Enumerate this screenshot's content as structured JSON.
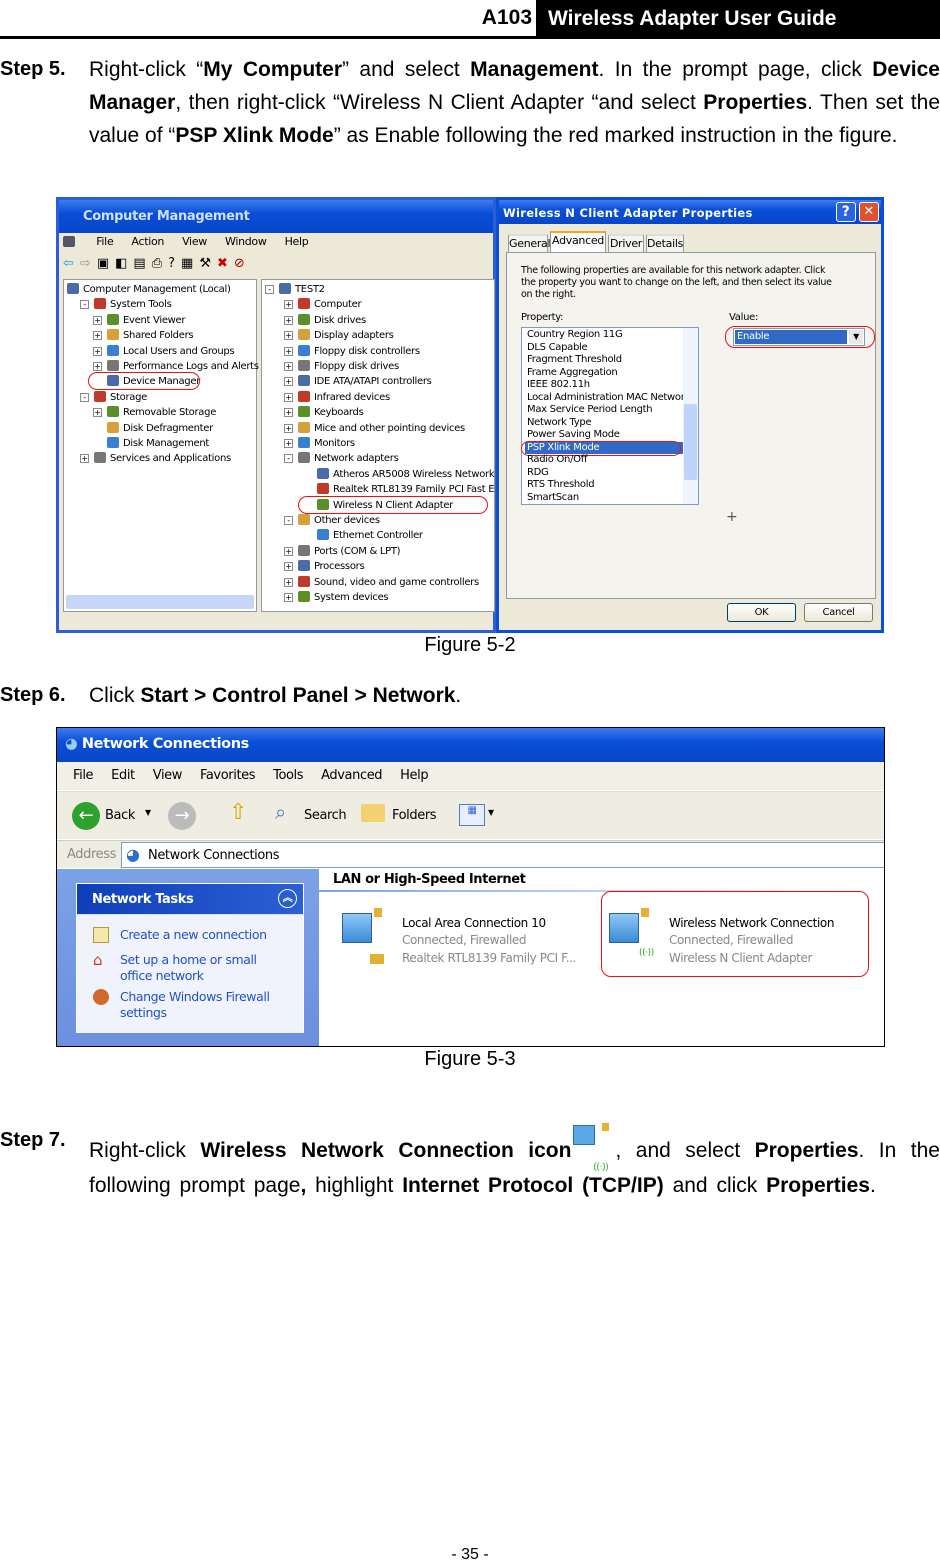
{
  "header": {
    "model": "A103",
    "title": "Wireless Adapter User Guide"
  },
  "step5": {
    "label": "Step 5.",
    "parts": [
      "Right-click “",
      "My Computer",
      "” and select ",
      "Management",
      ". In the prompt page, click ",
      "Device Manager",
      ", then right-click “Wireless N Client Adapter “and select ",
      "Properties",
      ". Then set the value of “",
      "PSP Xlink Mode",
      "” as Enable following the red marked instruction in the figure."
    ]
  },
  "fig52": {
    "caption": "Figure 5-2",
    "cm": {
      "title": "Computer Management",
      "menu": [
        "File",
        "Action",
        "View",
        "Window",
        "Help"
      ],
      "left_tree": [
        {
          "label": "Computer Management (Local)",
          "level": 0,
          "exp": ""
        },
        {
          "label": "System Tools",
          "level": 1,
          "exp": "-"
        },
        {
          "label": "Event Viewer",
          "level": 2,
          "exp": "+"
        },
        {
          "label": "Shared Folders",
          "level": 2,
          "exp": "+"
        },
        {
          "label": "Local Users and Groups",
          "level": 2,
          "exp": "+"
        },
        {
          "label": "Performance Logs and Alerts",
          "level": 2,
          "exp": "+"
        },
        {
          "label": "Device Manager",
          "level": 2,
          "exp": "",
          "mark": true
        },
        {
          "label": "Storage",
          "level": 1,
          "exp": "-"
        },
        {
          "label": "Removable Storage",
          "level": 2,
          "exp": "+"
        },
        {
          "label": "Disk Defragmenter",
          "level": 2,
          "exp": ""
        },
        {
          "label": "Disk Management",
          "level": 2,
          "exp": ""
        },
        {
          "label": "Services and Applications",
          "level": 1,
          "exp": "+"
        }
      ],
      "right_tree": [
        {
          "label": "TEST2",
          "level": 0,
          "exp": "-"
        },
        {
          "label": "Computer",
          "level": 1,
          "exp": "+"
        },
        {
          "label": "Disk drives",
          "level": 1,
          "exp": "+"
        },
        {
          "label": "Display adapters",
          "level": 1,
          "exp": "+"
        },
        {
          "label": "Floppy disk controllers",
          "level": 1,
          "exp": "+"
        },
        {
          "label": "Floppy disk drives",
          "level": 1,
          "exp": "+"
        },
        {
          "label": "IDE ATA/ATAPI controllers",
          "level": 1,
          "exp": "+"
        },
        {
          "label": "Infrared devices",
          "level": 1,
          "exp": "+"
        },
        {
          "label": "Keyboards",
          "level": 1,
          "exp": "+"
        },
        {
          "label": "Mice and other pointing devices",
          "level": 1,
          "exp": "+"
        },
        {
          "label": "Monitors",
          "level": 1,
          "exp": "+"
        },
        {
          "label": "Network adapters",
          "level": 1,
          "exp": "-"
        },
        {
          "label": "Atheros AR5008 Wireless Network",
          "level": 2,
          "exp": ""
        },
        {
          "label": "Realtek RTL8139 Family PCI Fast E",
          "level": 2,
          "exp": ""
        },
        {
          "label": "Wireless N Client Adapter",
          "level": 2,
          "exp": "",
          "mark": true
        },
        {
          "label": "Other devices",
          "level": 1,
          "exp": "-"
        },
        {
          "label": "Ethernet Controller",
          "level": 2,
          "exp": ""
        },
        {
          "label": "Ports (COM & LPT)",
          "level": 1,
          "exp": "+"
        },
        {
          "label": "Processors",
          "level": 1,
          "exp": "+"
        },
        {
          "label": "Sound, video and game controllers",
          "level": 1,
          "exp": "+"
        },
        {
          "label": "System devices",
          "level": 1,
          "exp": "+"
        }
      ]
    },
    "dlg": {
      "title": "Wireless N Client Adapter Properties",
      "tabs": [
        "General",
        "Advanced",
        "Driver",
        "Details"
      ],
      "active_tab": "Advanced",
      "desc": "The following properties are available for this network adapter. Click the property you want to change on the left, and then select its value on the right.",
      "property_label": "Property:",
      "value_label": "Value:",
      "value": "Enable",
      "properties": [
        "Country Region 11G",
        "DLS Capable",
        "Fragment Threshold",
        "Frame Aggregation",
        "IEEE 802.11h",
        "Local Administration MAC Network",
        "Max Service Period Length",
        "Network Type",
        "Power Saving Mode",
        "PSP Xlink Mode",
        "Radio On/Off",
        "RDG",
        "RTS Threshold",
        "SmartScan"
      ],
      "selected": "PSP Xlink Mode",
      "ok": "OK",
      "cancel": "Cancel",
      "help": "?",
      "close": "✕"
    }
  },
  "step6": {
    "label": "Step 6.",
    "parts": [
      "Click ",
      "Start > Control Panel > Network",
      "."
    ]
  },
  "fig53": {
    "caption": "Figure 5-3",
    "title": "Network Connections",
    "menu": [
      "File",
      "Edit",
      "View",
      "Favorites",
      "Tools",
      "Advanced",
      "Help"
    ],
    "toolbar": {
      "back": "Back",
      "search": "Search",
      "folders": "Folders"
    },
    "address_label": "Address",
    "address": "Network Connections",
    "tasks_title": "Network Tasks",
    "tasks": [
      "Create a new connection",
      "Set up a home or small office network",
      "Change Windows Firewall settings"
    ],
    "group": "LAN or High-Speed Internet",
    "connections": [
      {
        "name": "Local Area Connection 10",
        "status": "Connected, Firewalled",
        "device": "Realtek RTL8139 Family PCI F..."
      },
      {
        "name": "Wireless Network Connection",
        "status": "Connected, Firewalled",
        "device": "Wireless N Client Adapter",
        "mark": true
      }
    ]
  },
  "step7": {
    "label": "Step 7.",
    "parts": [
      "Right-click ",
      "Wireless Network Connection icon",
      ", and select ",
      "Properties",
      ". In the following prompt page",
      ",",
      " highlight ",
      "Internet Protocol (TCP/IP)",
      " and click ",
      "Properties",
      "."
    ]
  },
  "footer": {
    "page": "- 35 -"
  },
  "colors": {
    "xp_blue": "#0a4fd8",
    "xp_face": "#ece9d8",
    "select": "#316ac5",
    "mark": "#e11111"
  }
}
